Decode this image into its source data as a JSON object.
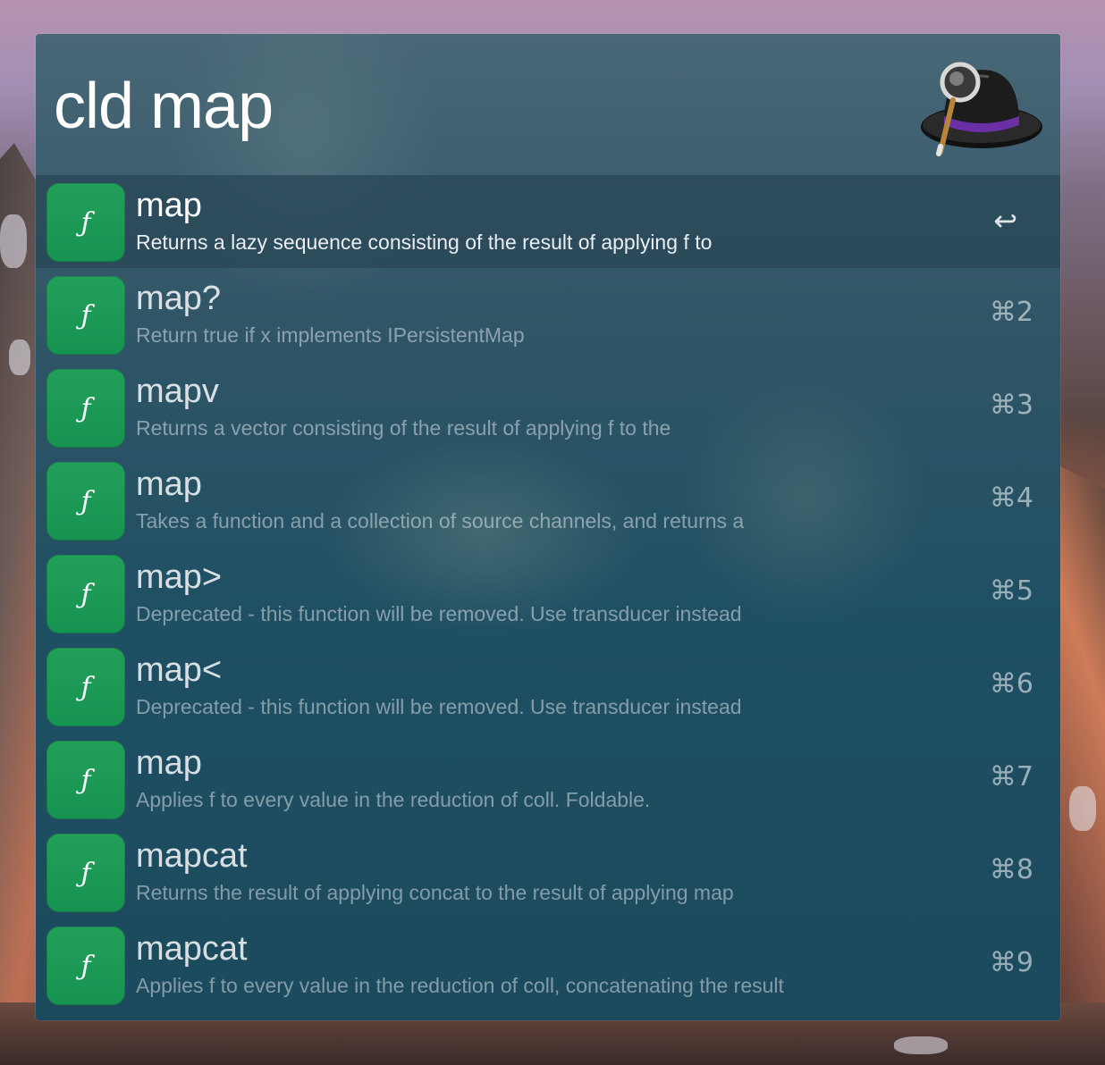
{
  "search": {
    "query": "cld map",
    "app_icon": "alfred-hat-icon"
  },
  "results": [
    {
      "title": "map",
      "subtitle": "Returns a lazy sequence consisting of the result of applying f to",
      "shortcut": "↩",
      "icon": "function-icon",
      "selected": true
    },
    {
      "title": "map?",
      "subtitle": "Return true if x implements IPersistentMap",
      "shortcut": "⌘2",
      "icon": "function-icon"
    },
    {
      "title": "mapv",
      "subtitle": "Returns a vector consisting of the result of applying f to the",
      "shortcut": "⌘3",
      "icon": "function-icon"
    },
    {
      "title": "map",
      "subtitle": "Takes a function and a collection of source channels, and returns a",
      "shortcut": "⌘4",
      "icon": "function-icon"
    },
    {
      "title": "map>",
      "subtitle": "Deprecated - this function will be removed. Use transducer instead",
      "shortcut": "⌘5",
      "icon": "function-icon"
    },
    {
      "title": "map<",
      "subtitle": "Deprecated - this function will be removed. Use transducer instead",
      "shortcut": "⌘6",
      "icon": "function-icon"
    },
    {
      "title": "map",
      "subtitle": "Applies f to every value in the reduction of coll. Foldable.",
      "shortcut": "⌘7",
      "icon": "function-icon"
    },
    {
      "title": "mapcat",
      "subtitle": "Returns the result of applying concat to the result of applying map",
      "shortcut": "⌘8",
      "icon": "function-icon"
    },
    {
      "title": "mapcat",
      "subtitle": "Applies f to every value in the reduction of coll, concatenating the result",
      "shortcut": "⌘9",
      "icon": "function-icon"
    }
  ],
  "icon_glyph": "ƒ",
  "colors": {
    "icon_green": "#1a9a55",
    "window_tint": "#2a5668",
    "selected_row": "#2c4a58"
  }
}
